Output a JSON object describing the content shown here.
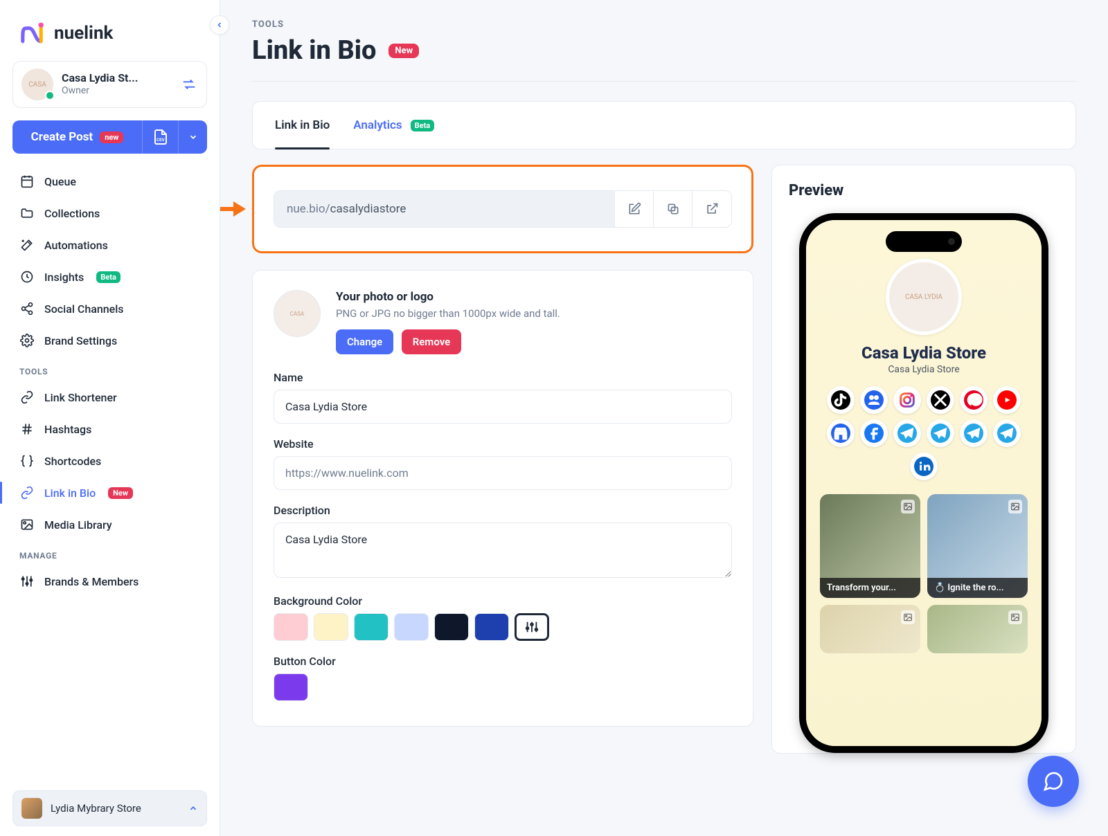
{
  "app": {
    "name": "nuelink"
  },
  "brand": {
    "name": "Casa Lydia St...",
    "role": "Owner"
  },
  "create_post": {
    "label": "Create Post",
    "badge": "new"
  },
  "nav": {
    "groups": [
      {
        "label": null,
        "items": [
          {
            "id": "queue",
            "label": "Queue",
            "icon": "calendar"
          },
          {
            "id": "collections",
            "label": "Collections",
            "icon": "folder"
          },
          {
            "id": "automations",
            "label": "Automations",
            "icon": "wand"
          },
          {
            "id": "insights",
            "label": "Insights",
            "icon": "clock",
            "badge": "Beta"
          },
          {
            "id": "social",
            "label": "Social Channels",
            "icon": "share"
          },
          {
            "id": "brand",
            "label": "Brand Settings",
            "icon": "gear"
          }
        ]
      },
      {
        "label": "TOOLS",
        "items": [
          {
            "id": "shortener",
            "label": "Link Shortener",
            "icon": "link"
          },
          {
            "id": "hashtags",
            "label": "Hashtags",
            "icon": "hash"
          },
          {
            "id": "shortcodes",
            "label": "Shortcodes",
            "icon": "braces"
          },
          {
            "id": "linkinbio",
            "label": "Link in Bio",
            "icon": "chain",
            "badge": "New",
            "active": true
          },
          {
            "id": "media",
            "label": "Media Library",
            "icon": "image"
          }
        ]
      },
      {
        "label": "MANAGE",
        "items": [
          {
            "id": "brands",
            "label": "Brands & Members",
            "icon": "sliders"
          }
        ]
      }
    ]
  },
  "user": {
    "name": "Lydia Mybrary Store"
  },
  "page": {
    "crumb": "TOOLS",
    "title": "Link in Bio",
    "badge": "New"
  },
  "tabs": [
    {
      "id": "link",
      "label": "Link in Bio",
      "active": true
    },
    {
      "id": "analytics",
      "label": "Analytics",
      "badge": "Beta"
    }
  ],
  "url": {
    "domain": "nue.bio/",
    "slug": "casalydiastore"
  },
  "form": {
    "photo_title": "Your photo or logo",
    "photo_sub": "PNG or JPG no bigger than 1000px wide and tall.",
    "change": "Change",
    "remove": "Remove",
    "name_label": "Name",
    "name_value": "Casa Lydia Store",
    "website_label": "Website",
    "website_placeholder": "https://www.nuelink.com",
    "website_value": "",
    "desc_label": "Description",
    "desc_value": "Casa Lydia Store",
    "bg_label": "Background Color",
    "bg_swatches": [
      "#fecdd3",
      "#fef3c7",
      "#22c1c3",
      "#c7d7fe",
      "#0f172a",
      "#1e40af"
    ],
    "btn_label": "Button Color",
    "btn_color": "#7c3aed"
  },
  "preview": {
    "title": "Preview",
    "brand_name": "Casa Lydia Store",
    "brand_sub": "Casa Lydia Store",
    "socials": [
      "tiktok",
      "group",
      "instagram",
      "x",
      "pinterest",
      "youtube",
      "gmb",
      "facebook",
      "telegram",
      "telegram",
      "telegram",
      "telegram",
      "linkedin"
    ],
    "cards": [
      {
        "caption": "Transform your...",
        "bg": "linear-gradient(135deg,#6b7a5a,#bfc8a8)"
      },
      {
        "caption": "💍 Ignite the ro...",
        "bg": "linear-gradient(135deg,#7fa3bf,#c9dbe8)"
      },
      {
        "caption": "",
        "bg": "linear-gradient(135deg,#d9cfa8,#efe7cc)",
        "fade": true
      },
      {
        "caption": "",
        "bg": "linear-gradient(135deg,#9fb07f,#d6dfc0)",
        "fade": true
      }
    ]
  }
}
